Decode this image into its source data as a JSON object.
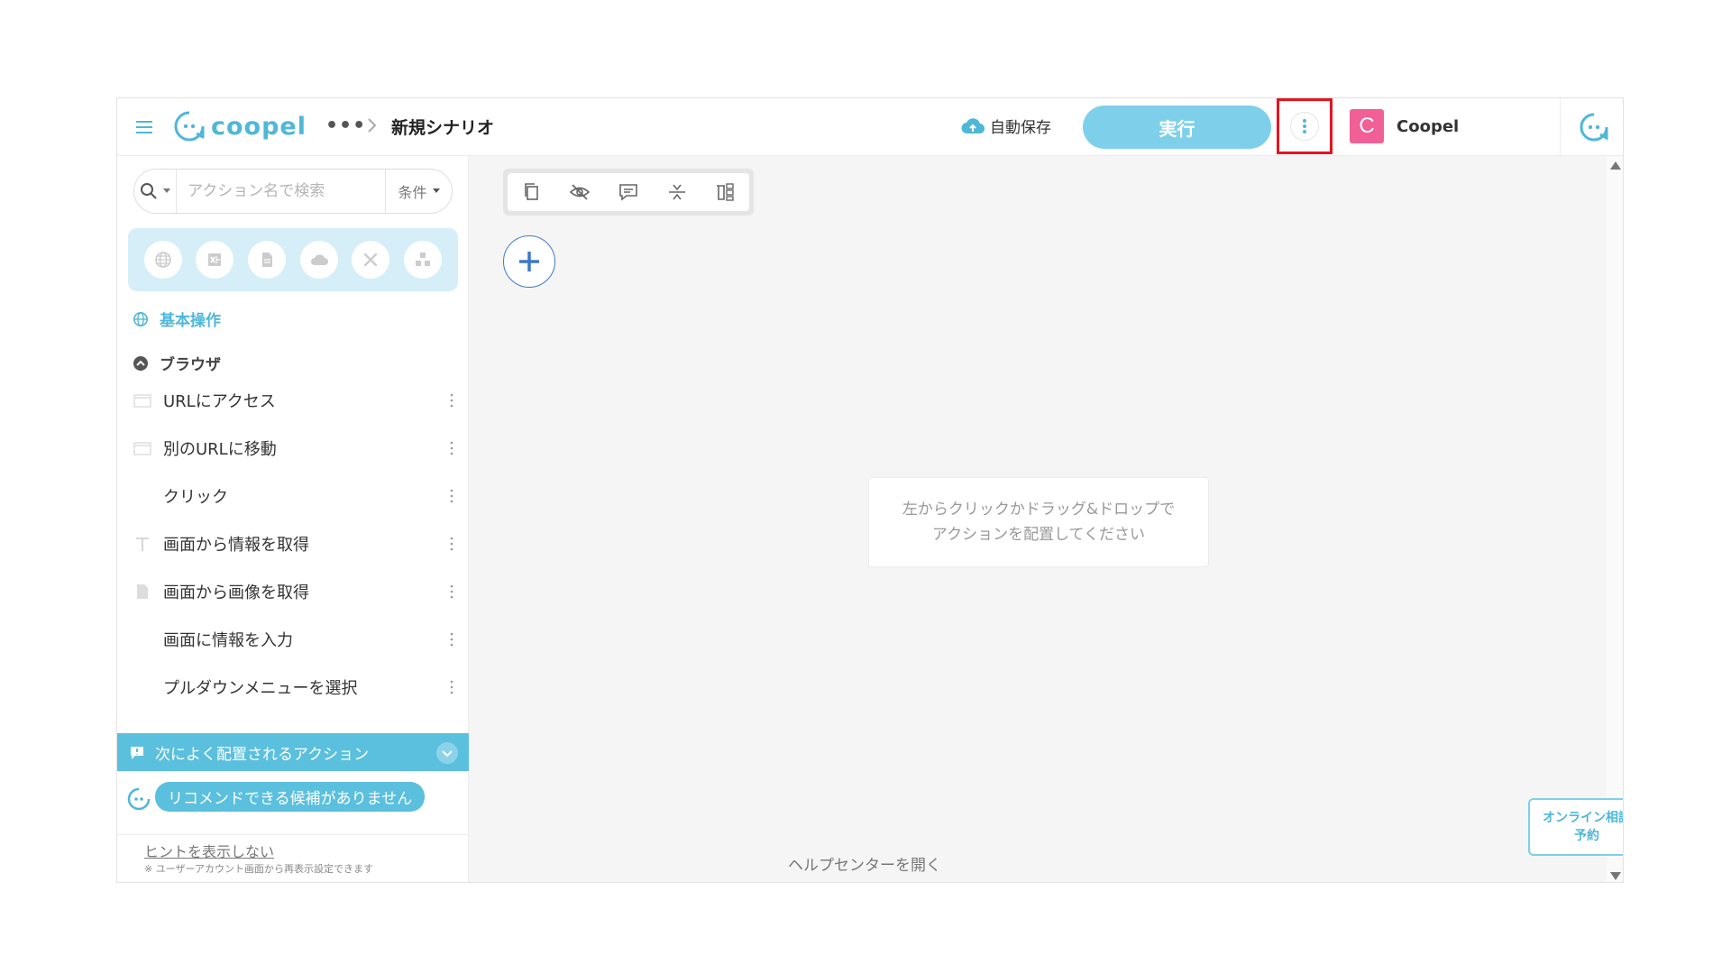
{
  "header": {
    "logo_text": "coopel",
    "breadcrumb_more": "•••",
    "scenario_title": "新規シナリオ",
    "autosave_label": "自動保存",
    "run_label": "実行",
    "user_avatar_letter": "C",
    "user_name": "Coopel"
  },
  "sidebar": {
    "search_placeholder": "アクション名で検索",
    "condition_label": "条件",
    "categories": [
      "globe-icon",
      "excel-icon",
      "document-icon",
      "cloud-icon",
      "tools-icon",
      "cluster-icon"
    ],
    "section_basic": "基本操作",
    "section_browser": "ブラウザ",
    "actions": [
      {
        "label": "URLにアクセス",
        "icon": "window-icon"
      },
      {
        "label": "別のURLに移動",
        "icon": "window-icon"
      },
      {
        "label": "クリック",
        "icon": ""
      },
      {
        "label": "画面から情報を取得",
        "icon": "text-icon"
      },
      {
        "label": "画面から画像を取得",
        "icon": "file-icon"
      },
      {
        "label": "画面に情報を入力",
        "icon": ""
      },
      {
        "label": "プルダウンメニューを選択",
        "icon": ""
      }
    ],
    "suggest_title": "次によく配置されるアクション",
    "recommend_text": "リコメンドできる候補がありません",
    "hint_link": "ヒントを表示しない",
    "hint_note": "※ ユーザーアカウント画面から再表示設定できます"
  },
  "canvas": {
    "drop_hint_line1": "左からクリックかドラッグ&ドロップで",
    "drop_hint_line2": "アクションを配置してください",
    "help_link": "ヘルプセンターを開く",
    "consult_line1": "オンライン相談",
    "consult_line2": "予約"
  },
  "colors": {
    "brand": "#4fb7d8",
    "run_button": "#7ed0ea",
    "highlight": "#e8131f",
    "avatar": "#f05f95"
  }
}
